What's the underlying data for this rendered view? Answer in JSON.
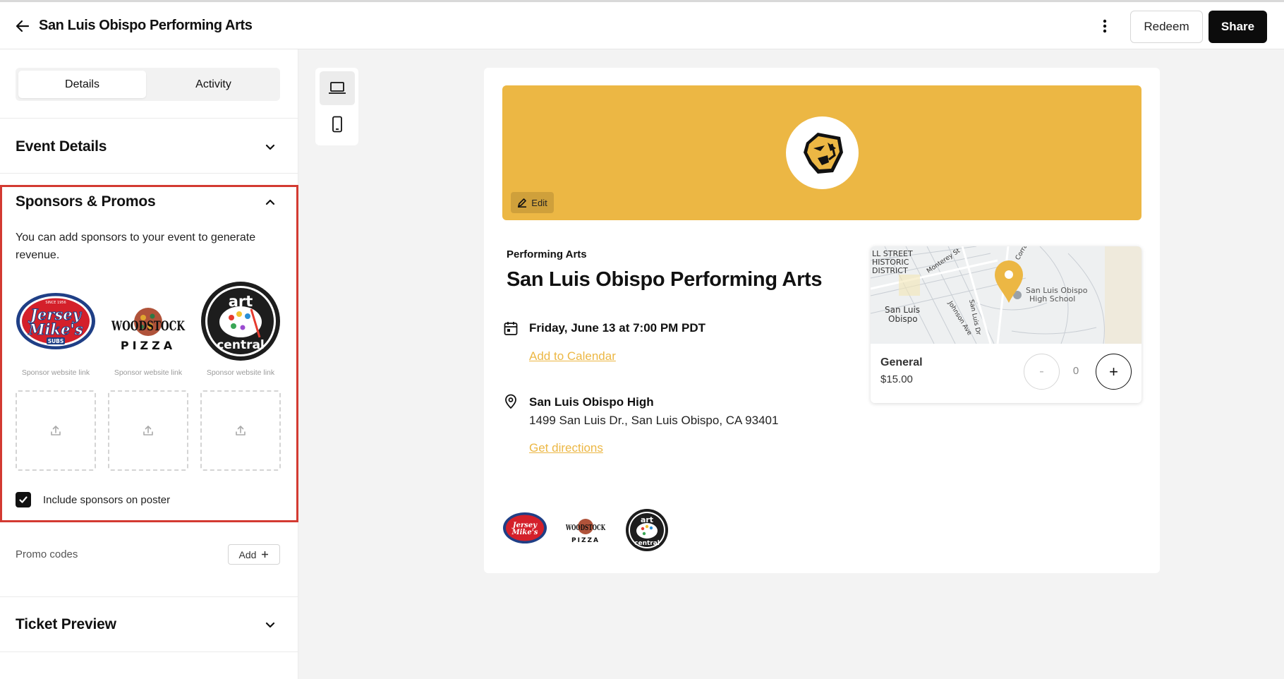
{
  "header": {
    "title": "San Luis Obispo Performing Arts",
    "redeem_label": "Redeem",
    "share_label": "Share"
  },
  "sidebar": {
    "tabs": [
      {
        "label": "Details",
        "active": true
      },
      {
        "label": "Activity",
        "active": false
      }
    ],
    "event_details_title": "Event Details",
    "sponsors": {
      "title": "Sponsors & Promos",
      "description": "You can add sponsors to your event to generate revenue.",
      "logos": [
        {
          "name": "Jersey Mike's Subs",
          "top_text": "SINCE 1956",
          "main_text": [
            "Jersey",
            "Mike's"
          ],
          "sub_text": "SUBS",
          "caption": "Sponsor website link"
        },
        {
          "name": "Woodstock Pizza",
          "main_text": [
            "WOODSTOCK"
          ],
          "sub_text": "PIZZA",
          "caption": "Sponsor website link"
        },
        {
          "name": "Art Central",
          "main_text": [
            "art",
            "central"
          ],
          "caption": "Sponsor website link"
        }
      ],
      "upload_slots": 3,
      "include_on_poster_label": "Include sponsors on poster",
      "include_on_poster_checked": true
    },
    "promo_codes_label": "Promo codes",
    "promo_add_label": "Add",
    "ticket_preview_title": "Ticket Preview"
  },
  "preview": {
    "edit_label": "Edit",
    "category": "Performing Arts",
    "title": "San Luis Obispo Performing Arts",
    "date": "Friday, June 13 at 7:00 PM PDT",
    "add_to_calendar": "Add to Calendar",
    "venue": "San Luis Obispo High",
    "address": "1499 San Luis Dr., San Luis Obispo, CA 93401",
    "get_directions": "Get directions",
    "map": {
      "labels": [
        "LL STREET",
        "HISTORIC",
        "DISTRICT",
        "Monterey St",
        "Corra",
        "San Luis",
        "Obispo",
        "Johnson Ave",
        "San Luis Dr",
        "San Luis Obispo",
        "High School"
      ]
    },
    "ticket": {
      "name": "General",
      "price": "$15.00",
      "minus": "-",
      "quantity": "0",
      "plus": "+"
    }
  },
  "colors": {
    "accent": "#ecb744",
    "highlight_border": "#d33a32",
    "primary_button": "#0c0c0c",
    "jersey_red": "#d4202a",
    "jersey_blue": "#1f3f86"
  },
  "icons": [
    "arrow-left-icon",
    "kebab-icon",
    "chevron-down-icon",
    "chevron-up-icon",
    "upload-icon",
    "check-icon",
    "plus-icon",
    "laptop-icon",
    "mobile-icon",
    "pencil-icon",
    "calendar-icon",
    "location-pin-icon"
  ]
}
